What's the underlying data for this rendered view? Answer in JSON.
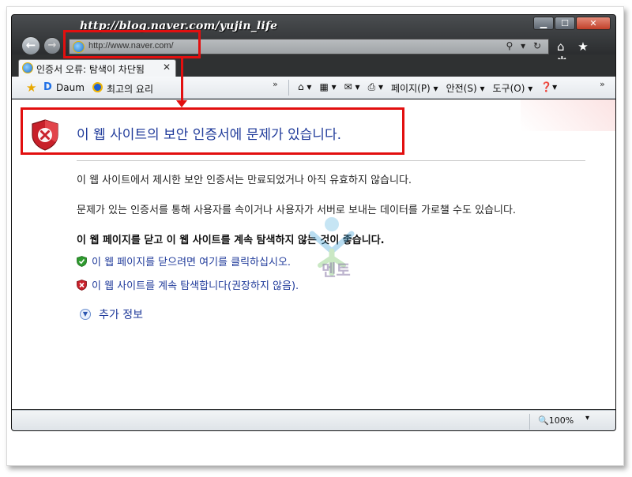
{
  "window": {
    "blog_overlay": "http://blog.naver.com/yujin_life",
    "minimize": "▁",
    "maximize": "☐",
    "close": "✕"
  },
  "nav": {
    "back": "←",
    "forward": "→"
  },
  "address": {
    "url": "http://www.naver.com/",
    "tools": "⚲ ▾ ↻"
  },
  "toolbar_right": "⌂ ★ ✲",
  "tab": {
    "label": "인증서 오류: 탐색이 차단됨",
    "close": "✕"
  },
  "favorites": {
    "items": [
      {
        "label": "Daum",
        "icon": "daum-icon"
      },
      {
        "label": "최고의 요리",
        "icon": "recipe-icon"
      }
    ],
    "overflow": "»"
  },
  "commandbar": {
    "home": "⌂ ▾",
    "feeds": "▦ ▾",
    "mail": "✉ ▾",
    "print": "⎙ ▾",
    "page": "페이지(P) ▾",
    "safety": "안전(S) ▾",
    "tools": "도구(O) ▾",
    "help": "❓▾",
    "overflow": "»"
  },
  "content": {
    "title": "이 웹 사이트의 보안 인증서에 문제가 있습니다.",
    "para1": "이 웹 사이트에서 제시한 보안 인증서는 만료되었거나 아직 유효하지 않습니다.",
    "para2": "문제가 있는 인증서를 통해 사용자를 속이거나 사용자가 서버로 보내는 데이터를 가로챌 수도 있습니다.",
    "para3": "이 웹 페이지를 닫고 이 웹 사이트를 계속 탐색하지 않는 것이 좋습니다.",
    "link_close": "이 웹 페이지를 닫으려면 여기를 클릭하십시오.",
    "link_continue": "이 웹 사이트를 계속 탐색합니다(권장하지 않음).",
    "more_info": "추가 정보",
    "watermark_text": "멘토"
  },
  "status": {
    "zoom": "100%",
    "zoom_caret": "▾"
  },
  "colors": {
    "annotation_red": "#e20f0f",
    "link_blue": "#1f3a9a"
  }
}
